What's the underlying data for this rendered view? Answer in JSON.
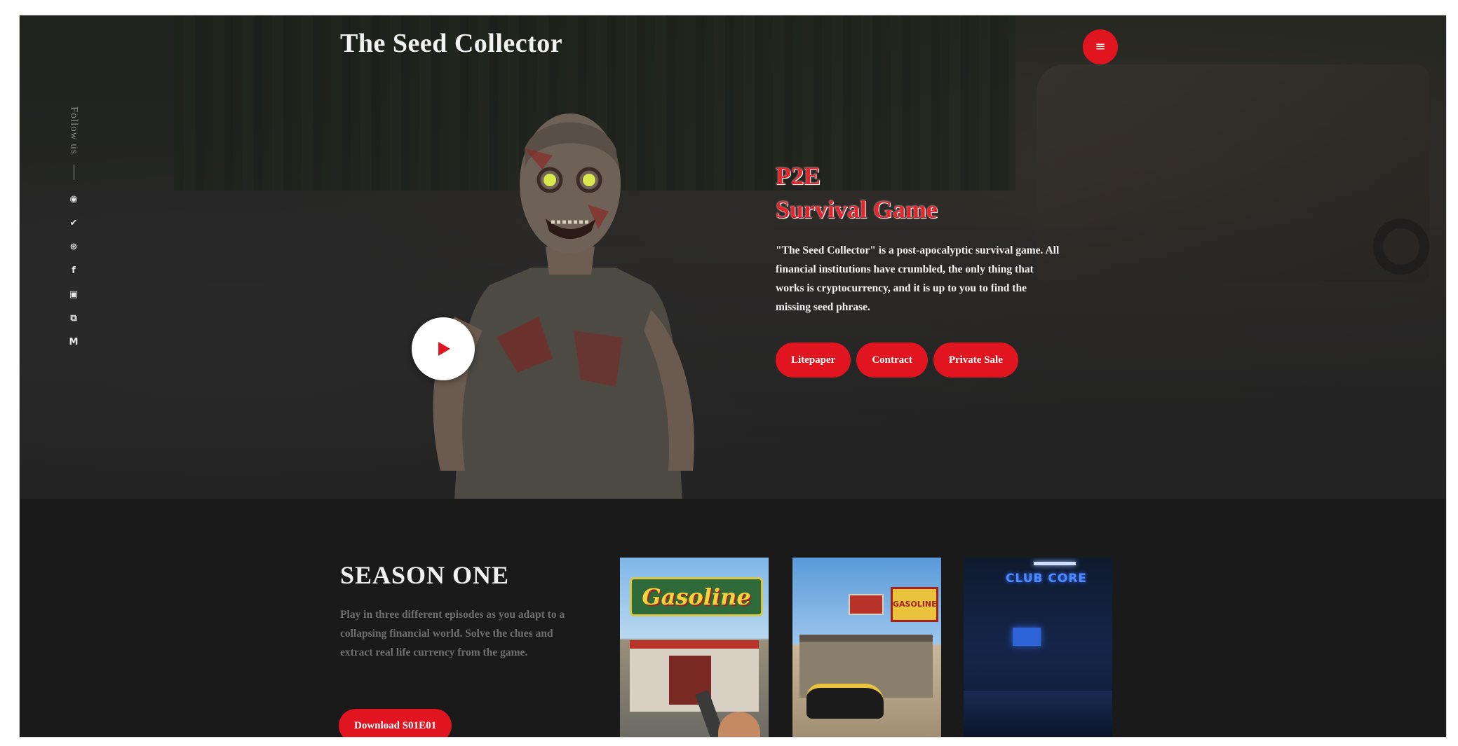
{
  "header": {
    "site_title": "The Seed Collector",
    "menu_icon": "hamburger-menu-icon",
    "menu_glyph": "≡"
  },
  "sidebar": {
    "follow_label": "Follow us",
    "social_icons": [
      {
        "name": "discord-icon",
        "glyph": "◉"
      },
      {
        "name": "twitter-icon",
        "glyph": "✔"
      },
      {
        "name": "telegram-icon",
        "glyph": "⊛"
      },
      {
        "name": "facebook-icon",
        "glyph": "f"
      },
      {
        "name": "youtube-icon",
        "glyph": "▣"
      },
      {
        "name": "twitch-icon",
        "glyph": "⧉"
      },
      {
        "name": "medium-icon",
        "glyph": "M"
      }
    ]
  },
  "hero": {
    "title_line1": "P2E",
    "title_line2": "Survival Game",
    "description": "\"The Seed Collector\" is a post-apocalyptic survival game. All financial institutions have crumbled, the only thing that works is cryptocurrency, and it is up to you to find the missing seed phrase.",
    "buttons": [
      "Litepaper",
      "Contract",
      "Private Sale"
    ],
    "play_icon": "play-icon"
  },
  "season": {
    "title": "SEASON ONE",
    "description": "Play in three different episodes as you adapt to a collapsing financial world. Solve the clues and extract real life currency from the game.",
    "download_label": "Download S01E01",
    "thumbnails": {
      "ep1_sign": "Gasoline",
      "ep2_sign": "GASOLINE",
      "ep3_sign": "CLUB CORE"
    }
  },
  "colors": {
    "accent": "#e0151f",
    "background": "#1b1b1c",
    "text": "#f2f2f2",
    "muted": "#6e6e6e"
  }
}
